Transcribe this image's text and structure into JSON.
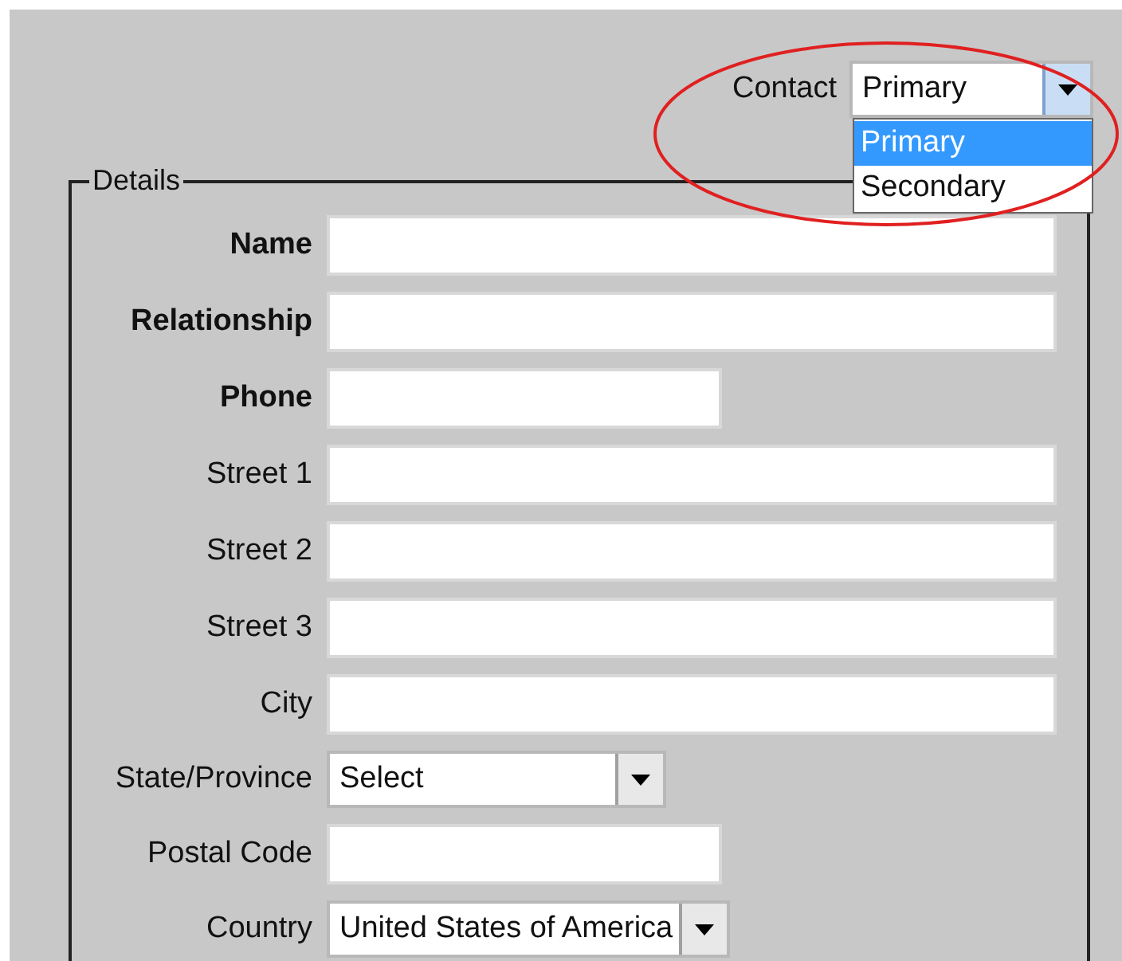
{
  "contact": {
    "label": "Contact",
    "value": "Primary",
    "expanded": true,
    "options": [
      {
        "label": "Primary",
        "selected": true
      },
      {
        "label": "Secondary",
        "selected": false
      }
    ]
  },
  "details": {
    "legend": "Details",
    "fields": [
      {
        "kind": "text",
        "label": "Name",
        "required": true
      },
      {
        "kind": "text",
        "label": "Relationship",
        "required": true
      },
      {
        "kind": "short_text",
        "label": "Phone",
        "required": true
      },
      {
        "kind": "text",
        "label": "Street 1",
        "required": false
      },
      {
        "kind": "text",
        "label": "Street 2",
        "required": false
      },
      {
        "kind": "text",
        "label": "Street 3",
        "required": false
      },
      {
        "kind": "text",
        "label": "City",
        "required": false
      },
      {
        "kind": "select",
        "label": "State/Province",
        "required": false,
        "value": "Select"
      },
      {
        "kind": "short_text",
        "label": "Postal Code",
        "required": false
      },
      {
        "kind": "select",
        "label": "Country",
        "required": false,
        "value": "United States of America"
      }
    ]
  }
}
